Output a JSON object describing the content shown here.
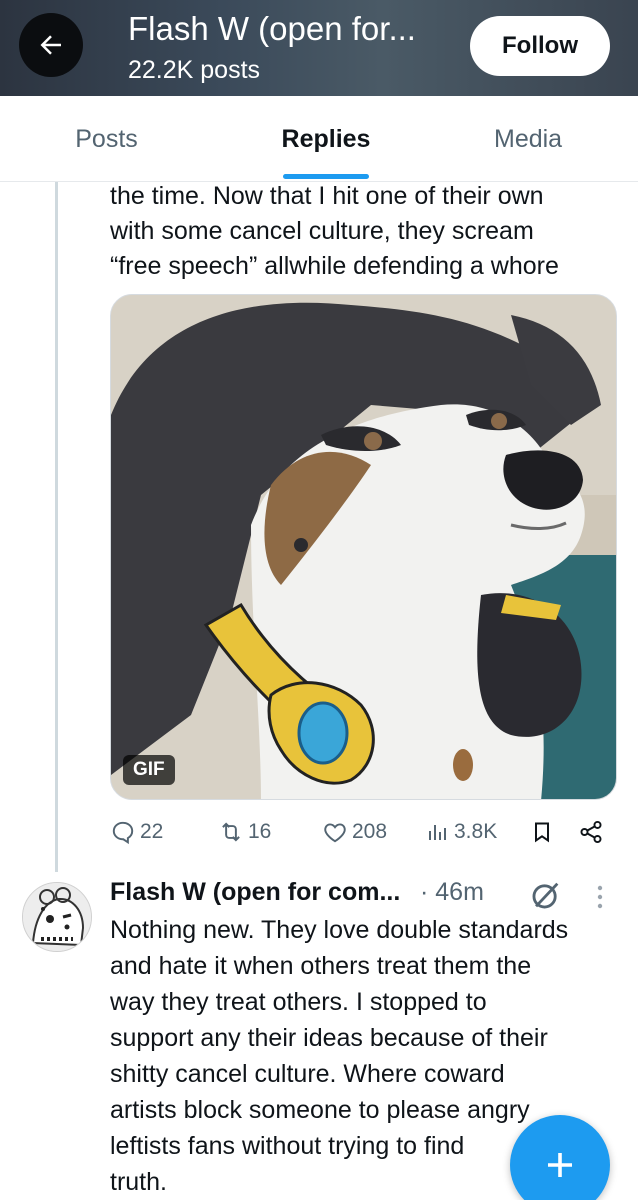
{
  "header": {
    "title": "Flash W (open for...",
    "posts_count": "22.2K posts",
    "follow_label": "Follow"
  },
  "tabs": [
    {
      "label": "Posts",
      "active": false
    },
    {
      "label": "Replies",
      "active": true
    },
    {
      "label": "Media",
      "active": false
    }
  ],
  "post": {
    "text_lines": [
      "the time. Now that I hit one of their own",
      "with some cancel culture, they scream",
      "“free speech” allwhile defending a whore"
    ],
    "media": {
      "type": "gif",
      "badge": "GIF",
      "icon": "cartoon-dog-with-headphones"
    },
    "actions": {
      "replies": "22",
      "reposts": "16",
      "likes": "208",
      "views": "3.8K"
    }
  },
  "reply": {
    "author": "Flash W (open for com...",
    "time": "· 46m",
    "text_lines": [
      "Nothing new. They love double standards",
      "and hate it when others treat them the",
      "way they treat others. I stopped to",
      "support any their ideas because of their",
      "shitty cancel culture. Where coward",
      "artists block someone to please angry",
      "leftists fans without trying to find",
      "truth."
    ]
  },
  "colors": {
    "accent": "#1d9bf0",
    "text": "#0f1419",
    "muted": "#536471"
  }
}
